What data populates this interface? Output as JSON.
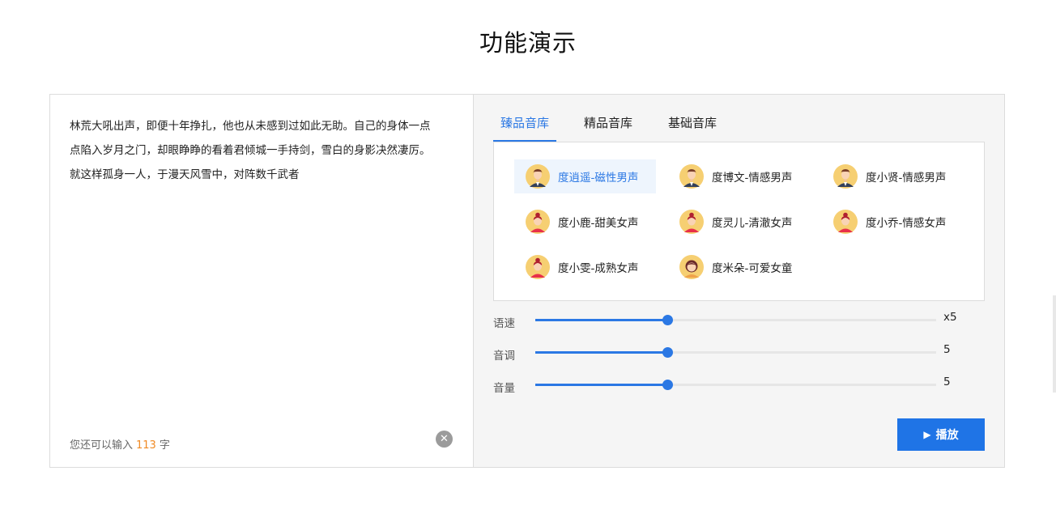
{
  "page": {
    "title": "功能演示"
  },
  "editor": {
    "lines": [
      "林荒大吼出声，即便十年挣扎，他也从未感到过如此无助。自己的身体一点",
      "点陷入岁月之门，却眼睁睁的看着君倾城一手持剑，雪白的身影决然凄厉。",
      "就这样孤身一人，于漫天风雪中，对阵数千武者"
    ],
    "counter_prefix": "您还可以输入",
    "counter_value": "113",
    "counter_suffix": "字",
    "clear_icon": "✕"
  },
  "tabs": [
    {
      "label": "臻品音库"
    },
    {
      "label": "精品音库"
    },
    {
      "label": "基础音库"
    }
  ],
  "voices": [
    {
      "label": "度逍遥-磁性男声",
      "gender": "male",
      "selected": true
    },
    {
      "label": "度博文-情感男声",
      "gender": "male"
    },
    {
      "label": "度小贤-情感男声",
      "gender": "male"
    },
    {
      "label": "度小鹿-甜美女声",
      "gender": "female"
    },
    {
      "label": "度灵儿-清澈女声",
      "gender": "female"
    },
    {
      "label": "度小乔-情感女声",
      "gender": "female"
    },
    {
      "label": "度小雯-成熟女声",
      "gender": "female"
    },
    {
      "label": "度米朵-可爱女童",
      "gender": "child"
    }
  ],
  "sliders": [
    {
      "label": "语速",
      "value": "x5",
      "level": 0.33
    },
    {
      "label": "音调",
      "value": "5",
      "level": 0.33
    },
    {
      "label": "音量",
      "value": "5",
      "level": 0.33
    }
  ],
  "play": {
    "label": "播放",
    "icon": "▶"
  },
  "colors": {
    "accent": "#2b78e4",
    "counter": "#f08a24",
    "avatar_bg": "#f6cf72"
  }
}
